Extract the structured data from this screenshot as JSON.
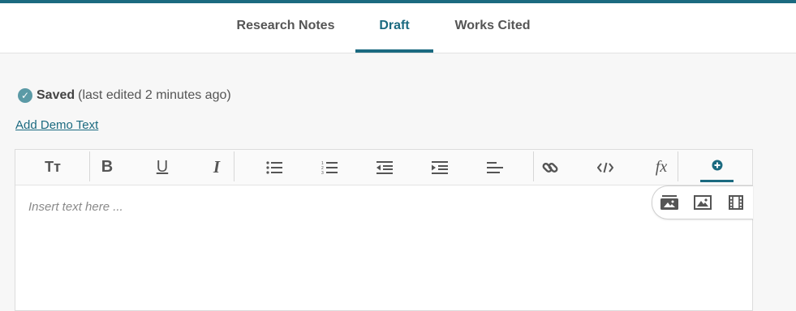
{
  "tabs": [
    {
      "label": "Research Notes",
      "active": false
    },
    {
      "label": "Draft",
      "active": true
    },
    {
      "label": "Works Cited",
      "active": false
    }
  ],
  "status": {
    "saved_label": "Saved",
    "meta": "(last edited 2 minutes ago)"
  },
  "demo_link": "Add Demo Text",
  "toolbar": {
    "items": [
      "text-size",
      "bold",
      "underline",
      "italic",
      "bulleted-list",
      "numbered-list",
      "outdent",
      "indent",
      "align-left",
      "link",
      "code",
      "formula",
      "insert-media"
    ],
    "text_size_glyph": "Tт",
    "bold_glyph": "B",
    "underline_glyph": "U",
    "italic_glyph": "I",
    "formula_glyph": "fx"
  },
  "editor": {
    "placeholder": "Insert text here ..."
  },
  "insert_menu": [
    "media-gallery",
    "image",
    "video"
  ],
  "colors": {
    "accent": "#1b6a80",
    "check": "#5b9aa6",
    "icon": "#555555"
  }
}
